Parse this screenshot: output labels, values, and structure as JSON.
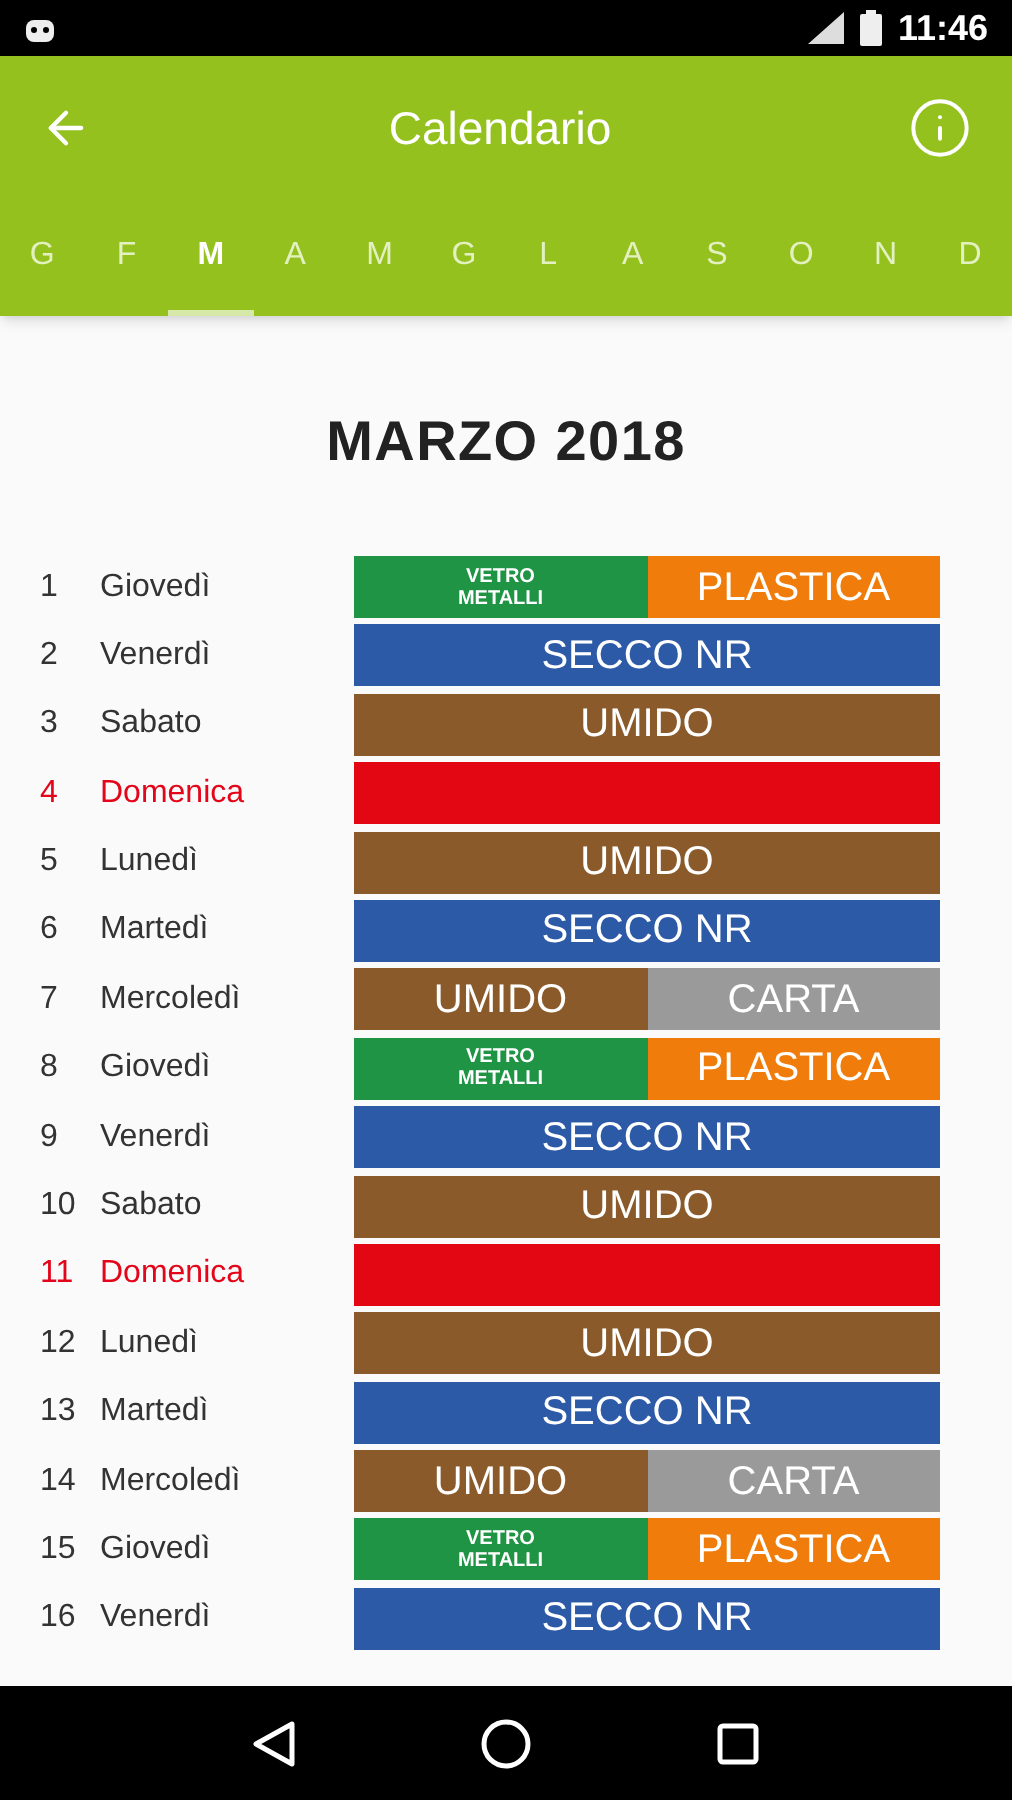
{
  "status_bar": {
    "time": "11:46"
  },
  "toolbar": {
    "title": "Calendario"
  },
  "months": [
    {
      "label": "G",
      "selected": false
    },
    {
      "label": "F",
      "selected": false
    },
    {
      "label": "M",
      "selected": true
    },
    {
      "label": "A",
      "selected": false
    },
    {
      "label": "M",
      "selected": false
    },
    {
      "label": "G",
      "selected": false
    },
    {
      "label": "L",
      "selected": false
    },
    {
      "label": "A",
      "selected": false
    },
    {
      "label": "S",
      "selected": false
    },
    {
      "label": "O",
      "selected": false
    },
    {
      "label": "N",
      "selected": false
    },
    {
      "label": "D",
      "selected": false
    }
  ],
  "heading": "MARZO 2018",
  "days": [
    {
      "day": "1",
      "name": "Giovedì",
      "holiday": false,
      "segments": [
        {
          "kind": "small",
          "label": "VETRO METALLI",
          "color": "#1e9444"
        },
        {
          "kind": "big",
          "label": "PLASTICA",
          "color": "#f07d0b"
        }
      ]
    },
    {
      "day": "2",
      "name": "Venerdì",
      "holiday": false,
      "segments": [
        {
          "kind": "big",
          "label": "SECCO NR",
          "color": "#2c5aa7"
        }
      ]
    },
    {
      "day": "3",
      "name": "Sabato",
      "holiday": false,
      "segments": [
        {
          "kind": "big",
          "label": "UMIDO",
          "color": "#8b5a2b"
        }
      ]
    },
    {
      "day": "4",
      "name": "Domenica",
      "holiday": true,
      "segments": [
        {
          "kind": "empty",
          "color": "#e30613"
        }
      ]
    },
    {
      "day": "5",
      "name": "Lunedì",
      "holiday": false,
      "segments": [
        {
          "kind": "big",
          "label": "UMIDO",
          "color": "#8b5a2b"
        }
      ]
    },
    {
      "day": "6",
      "name": "Martedì",
      "holiday": false,
      "segments": [
        {
          "kind": "big",
          "label": "SECCO NR",
          "color": "#2c5aa7"
        }
      ]
    },
    {
      "day": "7",
      "name": "Mercoledì",
      "holiday": false,
      "segments": [
        {
          "kind": "big",
          "label": "UMIDO",
          "color": "#8b5a2b"
        },
        {
          "kind": "big",
          "label": "CARTA",
          "color": "#9a9a9a"
        }
      ]
    },
    {
      "day": "8",
      "name": "Giovedì",
      "holiday": false,
      "segments": [
        {
          "kind": "small",
          "label": "VETRO METALLI",
          "color": "#1e9444"
        },
        {
          "kind": "big",
          "label": "PLASTICA",
          "color": "#f07d0b"
        }
      ]
    },
    {
      "day": "9",
      "name": "Venerdì",
      "holiday": false,
      "segments": [
        {
          "kind": "big",
          "label": "SECCO NR",
          "color": "#2c5aa7"
        }
      ]
    },
    {
      "day": "10",
      "name": "Sabato",
      "holiday": false,
      "segments": [
        {
          "kind": "big",
          "label": "UMIDO",
          "color": "#8b5a2b"
        }
      ]
    },
    {
      "day": "11",
      "name": "Domenica",
      "holiday": true,
      "segments": [
        {
          "kind": "empty",
          "color": "#e30613"
        }
      ]
    },
    {
      "day": "12",
      "name": "Lunedì",
      "holiday": false,
      "segments": [
        {
          "kind": "big",
          "label": "UMIDO",
          "color": "#8b5a2b"
        }
      ]
    },
    {
      "day": "13",
      "name": "Martedì",
      "holiday": false,
      "segments": [
        {
          "kind": "big",
          "label": "SECCO NR",
          "color": "#2c5aa7"
        }
      ]
    },
    {
      "day": "14",
      "name": "Mercoledì",
      "holiday": false,
      "segments": [
        {
          "kind": "big",
          "label": "UMIDO",
          "color": "#8b5a2b"
        },
        {
          "kind": "big",
          "label": "CARTA",
          "color": "#9a9a9a"
        }
      ]
    },
    {
      "day": "15",
      "name": "Giovedì",
      "holiday": false,
      "segments": [
        {
          "kind": "small",
          "label": "VETRO METALLI",
          "color": "#1e9444"
        },
        {
          "kind": "big",
          "label": "PLASTICA",
          "color": "#f07d0b"
        }
      ]
    },
    {
      "day": "16",
      "name": "Venerdì",
      "holiday": false,
      "segments": [
        {
          "kind": "big",
          "label": "SECCO NR",
          "color": "#2c5aa7"
        }
      ]
    }
  ]
}
